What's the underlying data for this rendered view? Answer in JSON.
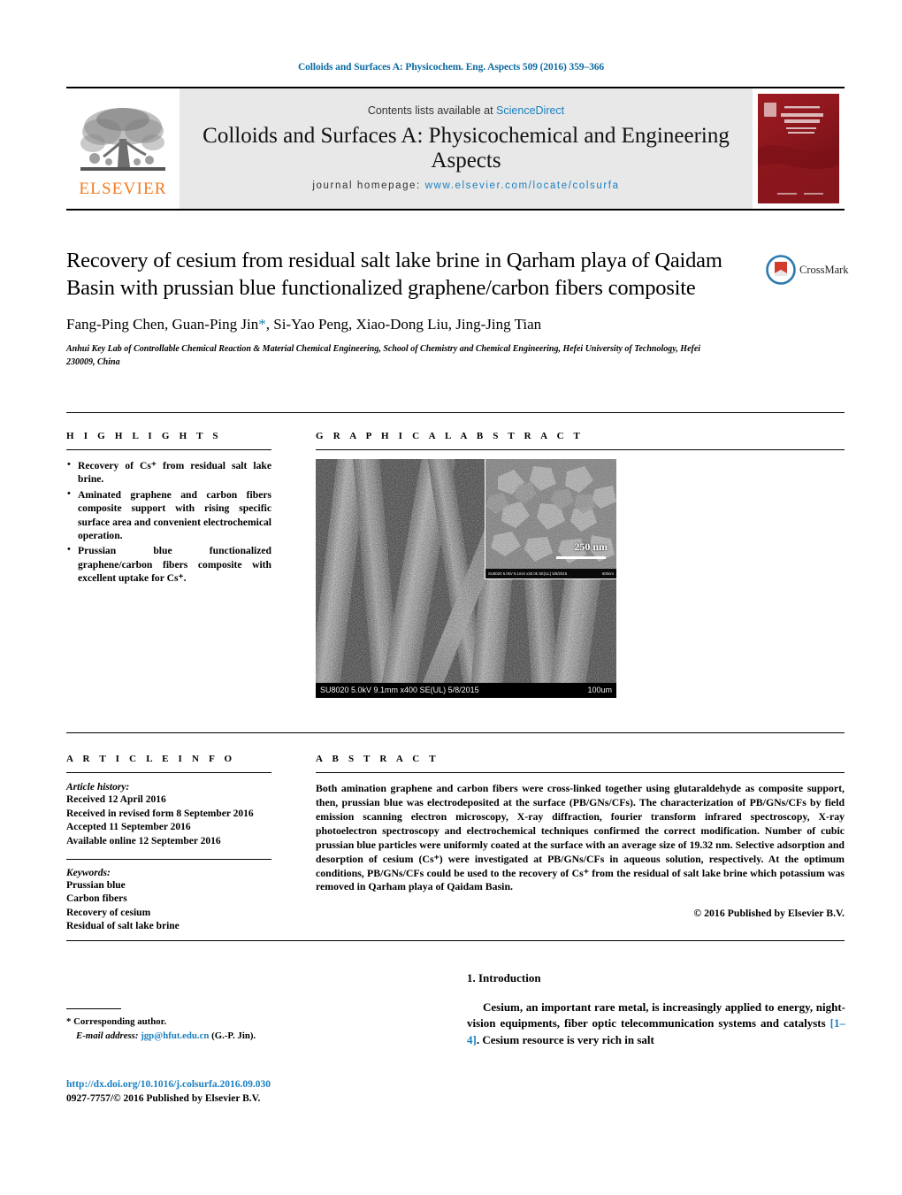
{
  "running_head": "Colloids and Surfaces A: Physicochem. Eng. Aspects 509 (2016) 359–366",
  "masthead": {
    "publisher_name": "ELSEVIER",
    "contents_prefix": "Contents lists available at",
    "contents_link": "ScienceDirect",
    "journal_title": "Colloids and Surfaces A: Physicochemical and Engineering Aspects",
    "homepage_prefix": "journal homepage:",
    "homepage_url": "www.elsevier.com/locate/colsurfa",
    "cover_journal_name": "COLLOIDS AND SURFACES A",
    "cover_subtitle": "Physicochemical and Engineering Aspects",
    "cover_kicker": "An International Journal"
  },
  "article": {
    "title": "Recovery of cesium from residual salt lake brine in Qarham playa of Qaidam Basin with prussian blue functionalized graphene/carbon fibers composite",
    "authors": "Fang-Ping Chen, Guan-Ping Jin",
    "authors_tail": ", Si-Yao Peng, Xiao-Dong Liu, Jing-Jing Tian",
    "corresponding_marker": "*",
    "affiliation": "Anhui Key Lab of Controllable Chemical Reaction & Material Chemical Engineering, School of Chemistry and Chemical Engineering, Hefei University of Technology, Hefei 230009, China",
    "crossmark_label": "CrossMark"
  },
  "highlights": {
    "heading": "H I G H L I G H T S",
    "items": [
      "Recovery of Cs⁺ from residual salt lake brine.",
      "Aminated graphene and carbon fibers composite support with rising specific surface area and convenient electrochemical operation.",
      "Prussian blue functionalized graphene/carbon fibers composite with excellent uptake for Cs⁺."
    ]
  },
  "graphical_abstract": {
    "heading": "G R A P H I C A L   A B S T R A C T",
    "image_caption_left": "SU8020 5.0kV 9.1mm x400 SE(UL) 5/8/2015",
    "image_caption_right": "100um",
    "inset_scale_label": "250 nm",
    "inset_caption_left": "SU8020 5.0kV 9.1mm x30.0k SE(UL) 5/8/2015",
    "inset_caption_right": "500nm"
  },
  "article_info": {
    "heading": "A R T I C L E   I N F O",
    "history_label": "Article history:",
    "history": [
      "Received 12 April 2016",
      "Received in revised form 8 September 2016",
      "Accepted 11 September 2016",
      "Available online 12 September 2016"
    ],
    "keywords_label": "Keywords:",
    "keywords": [
      "Prussian blue",
      "Carbon fibers",
      "Recovery of cesium",
      "Residual of salt lake brine"
    ]
  },
  "abstract": {
    "heading": "A B S T R A C T",
    "body": "Both amination graphene and carbon fibers were cross-linked together using glutaraldehyde as composite support, then, prussian blue was electrodeposited at the surface (PB/GNs/CFs). The characterization of PB/GNs/CFs by field emission scanning electron microscopy, X-ray diffraction, fourier transform infrared spectroscopy, X-ray photoelectron spectroscopy and electrochemical techniques confirmed the correct modification. Number of cubic prussian blue particles were uniformly coated at the surface with an average size of 19.32 nm. Selective adsorption and desorption of cesium (Cs⁺) were investigated at PB/GNs/CFs in aqueous solution, respectively. At the optimum conditions, PB/GNs/CFs could be used to the recovery of Cs⁺ from the residual of salt lake brine which potassium was removed in Qarham playa of Qaidam Basin.",
    "copyright": "© 2016 Published by Elsevier B.V."
  },
  "introduction": {
    "heading": "1.  Introduction",
    "paragraph_before_ref": "Cesium, an important rare metal, is increasingly applied to energy, night-vision equipments, fiber optic telecommunication systems and catalysts ",
    "reference": "[1–4]",
    "paragraph_after_ref": ". Cesium resource is very rich in salt"
  },
  "footnote": {
    "corresponding_author": "Corresponding author.",
    "marker": "*",
    "email_label": "E-mail address:",
    "email": "jgp@hfut.edu.cn",
    "email_owner": "(G.-P. Jin)."
  },
  "imprint": {
    "doi": "http://dx.doi.org/10.1016/j.colsurfa.2016.09.030",
    "issn_line": "0927-7757/© 2016 Published by Elsevier B.V."
  },
  "colors": {
    "link_blue": "#1a7fc1",
    "elsevier_orange": "#F57A20",
    "cover_red": "#9e1b22"
  }
}
